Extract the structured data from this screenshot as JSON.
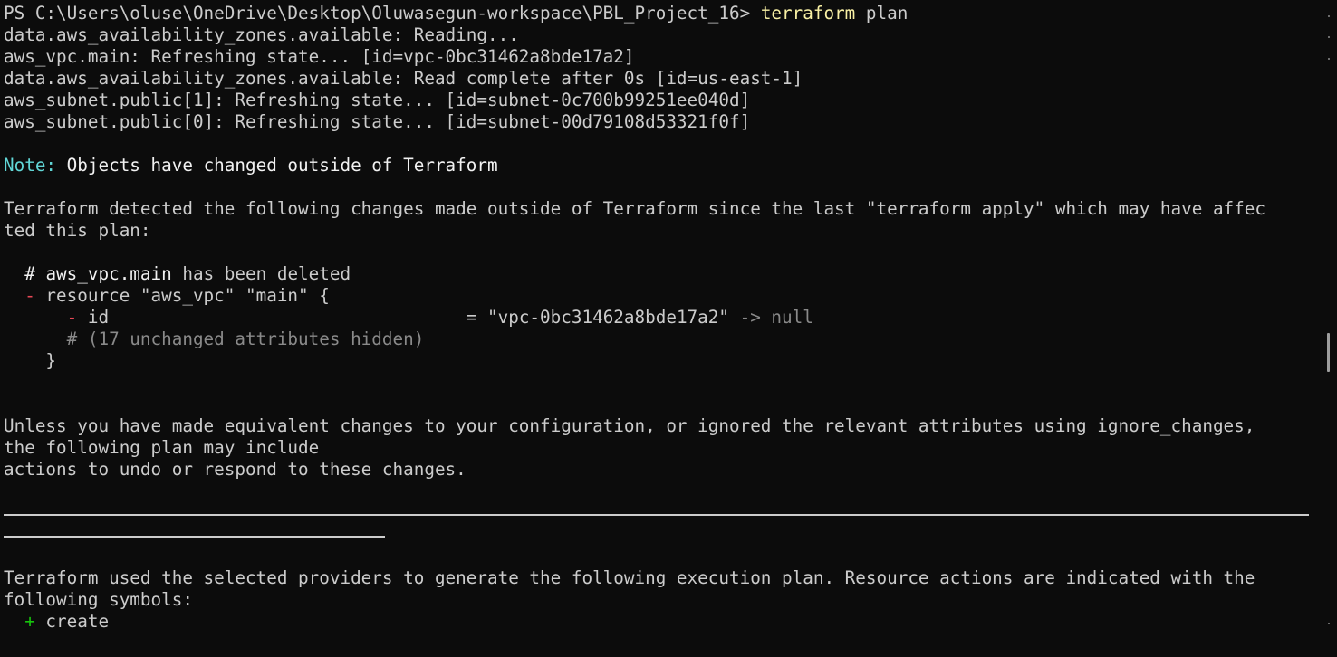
{
  "terminal": {
    "prompt": "PS C:\\Users\\oluse\\OneDrive\\Desktop\\Oluwasegun-workspace\\PBL_Project_16> ",
    "command": "terraform",
    "command_args": " plan",
    "refresh_lines": [
      "data.aws_availability_zones.available: Reading...",
      "aws_vpc.main: Refreshing state... [id=vpc-0bc31462a8bde17a2]",
      "data.aws_availability_zones.available: Read complete after 0s [id=us-east-1]",
      "aws_subnet.public[1]: Refreshing state... [id=subnet-0c700b99251ee040d]",
      "aws_subnet.public[0]: Refreshing state... [id=subnet-00d79108d53321f0f]"
    ],
    "note_label": "Note:",
    "note_text": " Objects have changed outside of Terraform",
    "detected_line_1": "Terraform detected the following changes made outside of Terraform since the last \"terraform apply\" which may have affec",
    "detected_line_2": "ted this plan:",
    "diff": {
      "comment_prefix": "  # ",
      "comment_resource": "aws_vpc.main",
      "comment_rest": " has been deleted",
      "minus": "-",
      "resource_line": " resource \"aws_vpc\" \"main\" {",
      "attr_minus": "-",
      "attr_name": " id                                  = ",
      "attr_value": "\"vpc-0bc31462a8bde17a2\"",
      "attr_arrow": " -> null",
      "hidden_attrs": "      # (17 unchanged attributes hidden)",
      "close_brace": "    }"
    },
    "unless_line_1": "Unless you have made equivalent changes to your configuration, or ignored the relevant attributes using ignore_changes,",
    "unless_line_2": "the following plan may include",
    "unless_line_3": "actions to undo or respond to these changes.",
    "used_line_1": "Terraform used the selected providers to generate the following execution plan. Resource actions are indicated with the",
    "used_line_2": "following symbols:",
    "plus": "+",
    "create_label": " create"
  }
}
